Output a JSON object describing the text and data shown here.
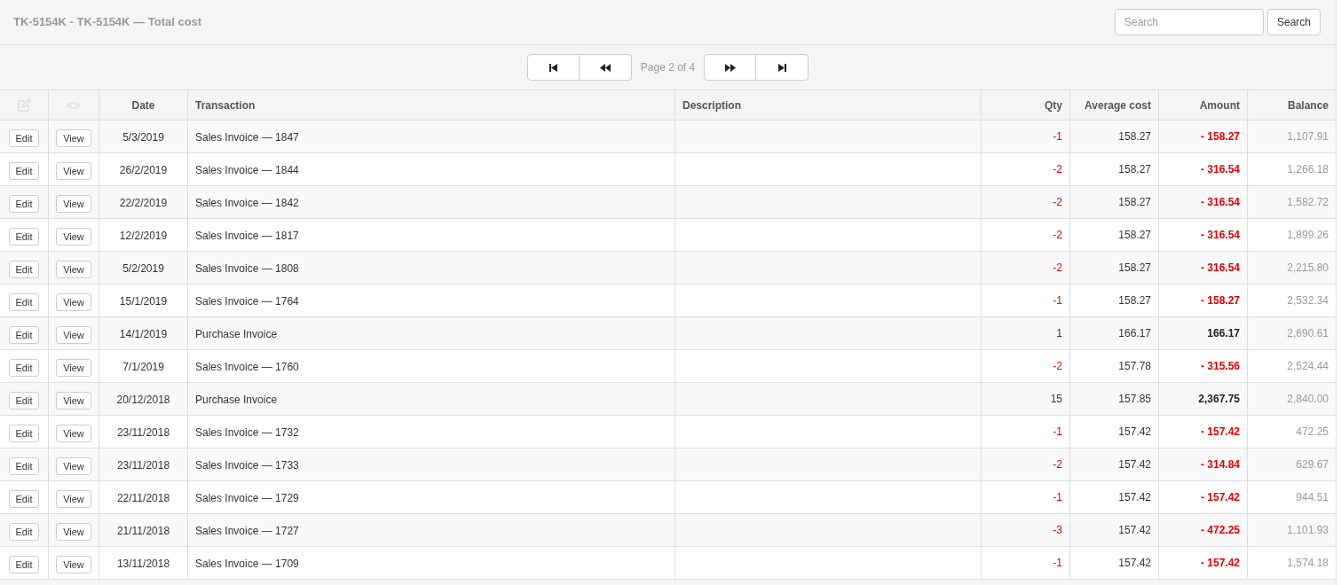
{
  "title": "TK-5154K - TK-5154K — Total cost",
  "search": {
    "placeholder": "Search",
    "button": "Search"
  },
  "pager": {
    "label": "Page 2 of 4"
  },
  "columns": [
    "Date",
    "Transaction",
    "Description",
    "Qty",
    "Average cost",
    "Amount",
    "Balance"
  ],
  "rows": [
    {
      "edit": "Edit",
      "view": "View",
      "date": "5/3/2019",
      "transaction": "Sales Invoice — 1847",
      "qty": "-1",
      "avg": "158.27",
      "amount": "- 158.27",
      "balance": "1,107.91",
      "kind": "out"
    },
    {
      "edit": "Edit",
      "view": "View",
      "date": "26/2/2019",
      "transaction": "Sales Invoice — 1844",
      "qty": "-2",
      "avg": "158.27",
      "amount": "- 316.54",
      "balance": "1,266.18",
      "kind": "out"
    },
    {
      "edit": "Edit",
      "view": "View",
      "date": "22/2/2019",
      "transaction": "Sales Invoice — 1842",
      "qty": "-2",
      "avg": "158.27",
      "amount": "- 316.54",
      "balance": "1,582.72",
      "kind": "out"
    },
    {
      "edit": "Edit",
      "view": "View",
      "date": "12/2/2019",
      "transaction": "Sales Invoice — 1817",
      "qty": "-2",
      "avg": "158.27",
      "amount": "- 316.54",
      "balance": "1,899.26",
      "kind": "out"
    },
    {
      "edit": "Edit",
      "view": "View",
      "date": "5/2/2019",
      "transaction": "Sales Invoice — 1808",
      "qty": "-2",
      "avg": "158.27",
      "amount": "- 316.54",
      "balance": "2,215.80",
      "kind": "out"
    },
    {
      "edit": "Edit",
      "view": "View",
      "date": "15/1/2019",
      "transaction": "Sales Invoice — 1764",
      "qty": "-1",
      "avg": "158.27",
      "amount": "- 158.27",
      "balance": "2,532.34",
      "kind": "out"
    },
    {
      "edit": "Edit",
      "view": "View",
      "date": "14/1/2019",
      "transaction": "Purchase Invoice",
      "qty": "1",
      "avg": "166.17",
      "amount": "166.17",
      "balance": "2,690.61",
      "kind": "in"
    },
    {
      "edit": "Edit",
      "view": "View",
      "date": "7/1/2019",
      "transaction": "Sales Invoice — 1760",
      "qty": "-2",
      "avg": "157.78",
      "amount": "- 315.56",
      "balance": "2,524.44",
      "kind": "out"
    },
    {
      "edit": "Edit",
      "view": "View",
      "date": "20/12/2018",
      "transaction": "Purchase Invoice",
      "qty": "15",
      "avg": "157.85",
      "amount": "2,367.75",
      "balance": "2,840.00",
      "kind": "in"
    },
    {
      "edit": "Edit",
      "view": "View",
      "date": "23/11/2018",
      "transaction": "Sales Invoice — 1732",
      "qty": "-1",
      "avg": "157.42",
      "amount": "- 157.42",
      "balance": "472.25",
      "kind": "out"
    },
    {
      "edit": "Edit",
      "view": "View",
      "date": "23/11/2018",
      "transaction": "Sales Invoice — 1733",
      "qty": "-2",
      "avg": "157.42",
      "amount": "- 314.84",
      "balance": "629.67",
      "kind": "out"
    },
    {
      "edit": "Edit",
      "view": "View",
      "date": "22/11/2018",
      "transaction": "Sales Invoice — 1729",
      "qty": "-1",
      "avg": "157.42",
      "amount": "- 157.42",
      "balance": "944.51",
      "kind": "out"
    },
    {
      "edit": "Edit",
      "view": "View",
      "date": "21/11/2018",
      "transaction": "Sales Invoice — 1727",
      "qty": "-3",
      "avg": "157.42",
      "amount": "- 472.25",
      "balance": "1,101.93",
      "kind": "out"
    },
    {
      "edit": "Edit",
      "view": "View",
      "date": "13/11/2018",
      "transaction": "Sales Invoice — 1709",
      "qty": "-1",
      "avg": "157.42",
      "amount": "- 157.42",
      "balance": "1,574.18",
      "kind": "out"
    }
  ]
}
